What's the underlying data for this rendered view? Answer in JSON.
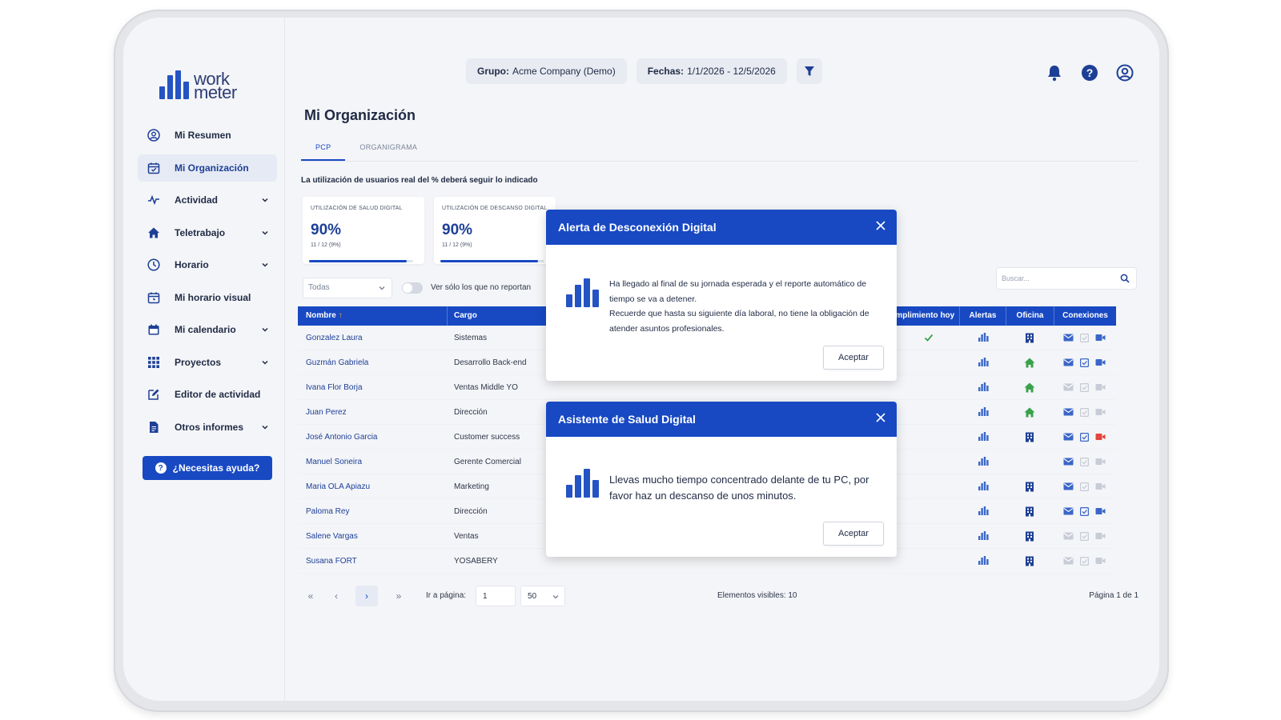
{
  "window": {
    "traffic_lights": [
      "#ef5b4f",
      "#f4b02f",
      "#35c24a"
    ]
  },
  "brand": {
    "logo_text_1": "work",
    "logo_text_2": "meter",
    "primary_color": "#1849c3"
  },
  "sidebar": {
    "items": [
      {
        "label": "Mi Resumen",
        "icon": "user-circle-icon",
        "active": false,
        "has_chevron": false
      },
      {
        "label": "Mi Organización",
        "icon": "calendar-check-icon",
        "active": true,
        "has_chevron": false
      },
      {
        "label": "Actividad",
        "icon": "activity-icon",
        "active": false,
        "has_chevron": true
      },
      {
        "label": "Teletrabajo",
        "icon": "home-icon",
        "active": false,
        "has_chevron": true
      },
      {
        "label": "Horario",
        "icon": "clock-icon",
        "active": false,
        "has_chevron": true
      },
      {
        "label": "Mi horario visual",
        "icon": "calendar-clock-icon",
        "active": false,
        "has_chevron": false
      },
      {
        "label": "Mi calendario",
        "icon": "calendar-icon",
        "active": false,
        "has_chevron": true
      },
      {
        "label": "Proyectos",
        "icon": "grid-icon",
        "active": false,
        "has_chevron": true
      },
      {
        "label": "Editor de actividad",
        "icon": "edit-icon",
        "active": false,
        "has_chevron": false
      },
      {
        "label": "Otros informes",
        "icon": "document-icon",
        "active": false,
        "has_chevron": true
      }
    ],
    "help_button": "¿Necesitas ayuda?"
  },
  "header": {
    "group_label": "Grupo:",
    "group_value": "Acme Company (Demo)",
    "dates_label": "Fechas:",
    "dates_value": "1/1/2026 - 12/5/2026"
  },
  "page": {
    "title": "Mi Organización",
    "tabs": [
      {
        "label": "PCP",
        "active": true
      },
      {
        "label": "ORGANIGRAMA",
        "active": false
      }
    ],
    "notice": "La utilización de usuarios real del % deberá seguir lo indicado"
  },
  "cards": [
    {
      "label": "UTILIZACIÓN DE SALUD DIGITAL",
      "value": "90%",
      "sub": "11 / 12 (9%)",
      "progress": 0.94
    },
    {
      "label": "UTILIZACIÓN DE DESCANSO DIGITAL",
      "value": "90%",
      "sub": "11 / 12 (9%)",
      "progress": 0.94
    }
  ],
  "filters": {
    "select_value": "Todas",
    "toggle_label": "Ver sólo los que no reportan",
    "toggle_on": false,
    "search_placeholder": "Buscar..."
  },
  "table": {
    "headers": {
      "name": "Nombre",
      "role": "Cargo",
      "compliance": "Cumplimiento hoy",
      "alerts": "Alertas",
      "office": "Oficina",
      "connections": "Conexiones"
    },
    "rows": [
      {
        "name": "Gonzalez Laura",
        "role": "Sistemas",
        "compliance": true,
        "office": "building",
        "conn": [
          1,
          0,
          1
        ]
      },
      {
        "name": "Guzmán Gabriela",
        "role": "Desarrollo Back-end",
        "compliance": false,
        "office": "home",
        "conn": [
          1,
          1,
          1
        ]
      },
      {
        "name": "Ivana Flor Borja",
        "role": "Ventas Middle YO",
        "compliance": false,
        "office": "home",
        "conn": [
          0,
          0,
          0
        ]
      },
      {
        "name": "Juan Perez",
        "role": "Dirección",
        "compliance": false,
        "office": "home",
        "conn": [
          1,
          0,
          0
        ]
      },
      {
        "name": "José Antonio Garcia",
        "role": "Customer success",
        "compliance": false,
        "office": "building",
        "conn": [
          1,
          1,
          2
        ]
      },
      {
        "name": "Manuel Soneira",
        "role": "Gerente Comercial",
        "compliance": false,
        "office": "none",
        "conn": [
          1,
          0,
          0
        ]
      },
      {
        "name": "Maria OLA Apiazu",
        "role": "Marketing",
        "compliance": false,
        "office": "building",
        "conn": [
          1,
          0,
          0
        ]
      },
      {
        "name": "Paloma Rey",
        "role": "Dirección",
        "compliance": false,
        "office": "building",
        "conn": [
          1,
          1,
          1
        ]
      },
      {
        "name": "Salene Vargas",
        "role": "Ventas",
        "compliance": false,
        "office": "building",
        "conn": [
          0,
          0,
          0
        ]
      },
      {
        "name": "Susana FORT",
        "role": "YOSABERY",
        "compliance": false,
        "office": "building",
        "conn": [
          0,
          0,
          0
        ]
      }
    ]
  },
  "pagination": {
    "first": "«",
    "prev": "‹",
    "next": "›",
    "last": "»",
    "goto_label": "Ir a página:",
    "page_value": "1",
    "per_page": "50",
    "visible": "Elementos visibles: 10",
    "page_of": "Página 1 de 1"
  },
  "modal_disconnect": {
    "title": "Alerta de Desconexión Digital",
    "line1": "Ha llegado al final de su jornada esperada y el reporte automático de tiempo se va a detener.",
    "line2": "Recuerde que hasta su siguiente día laboral, no tiene la obligación de atender asuntos profesionales.",
    "button": "Aceptar"
  },
  "modal_health": {
    "title": "Asistente de Salud Digital",
    "text": "Llevas mucho tiempo concentrado delante de tu PC, por favor haz un descanso de unos minutos.",
    "button": "Aceptar"
  }
}
